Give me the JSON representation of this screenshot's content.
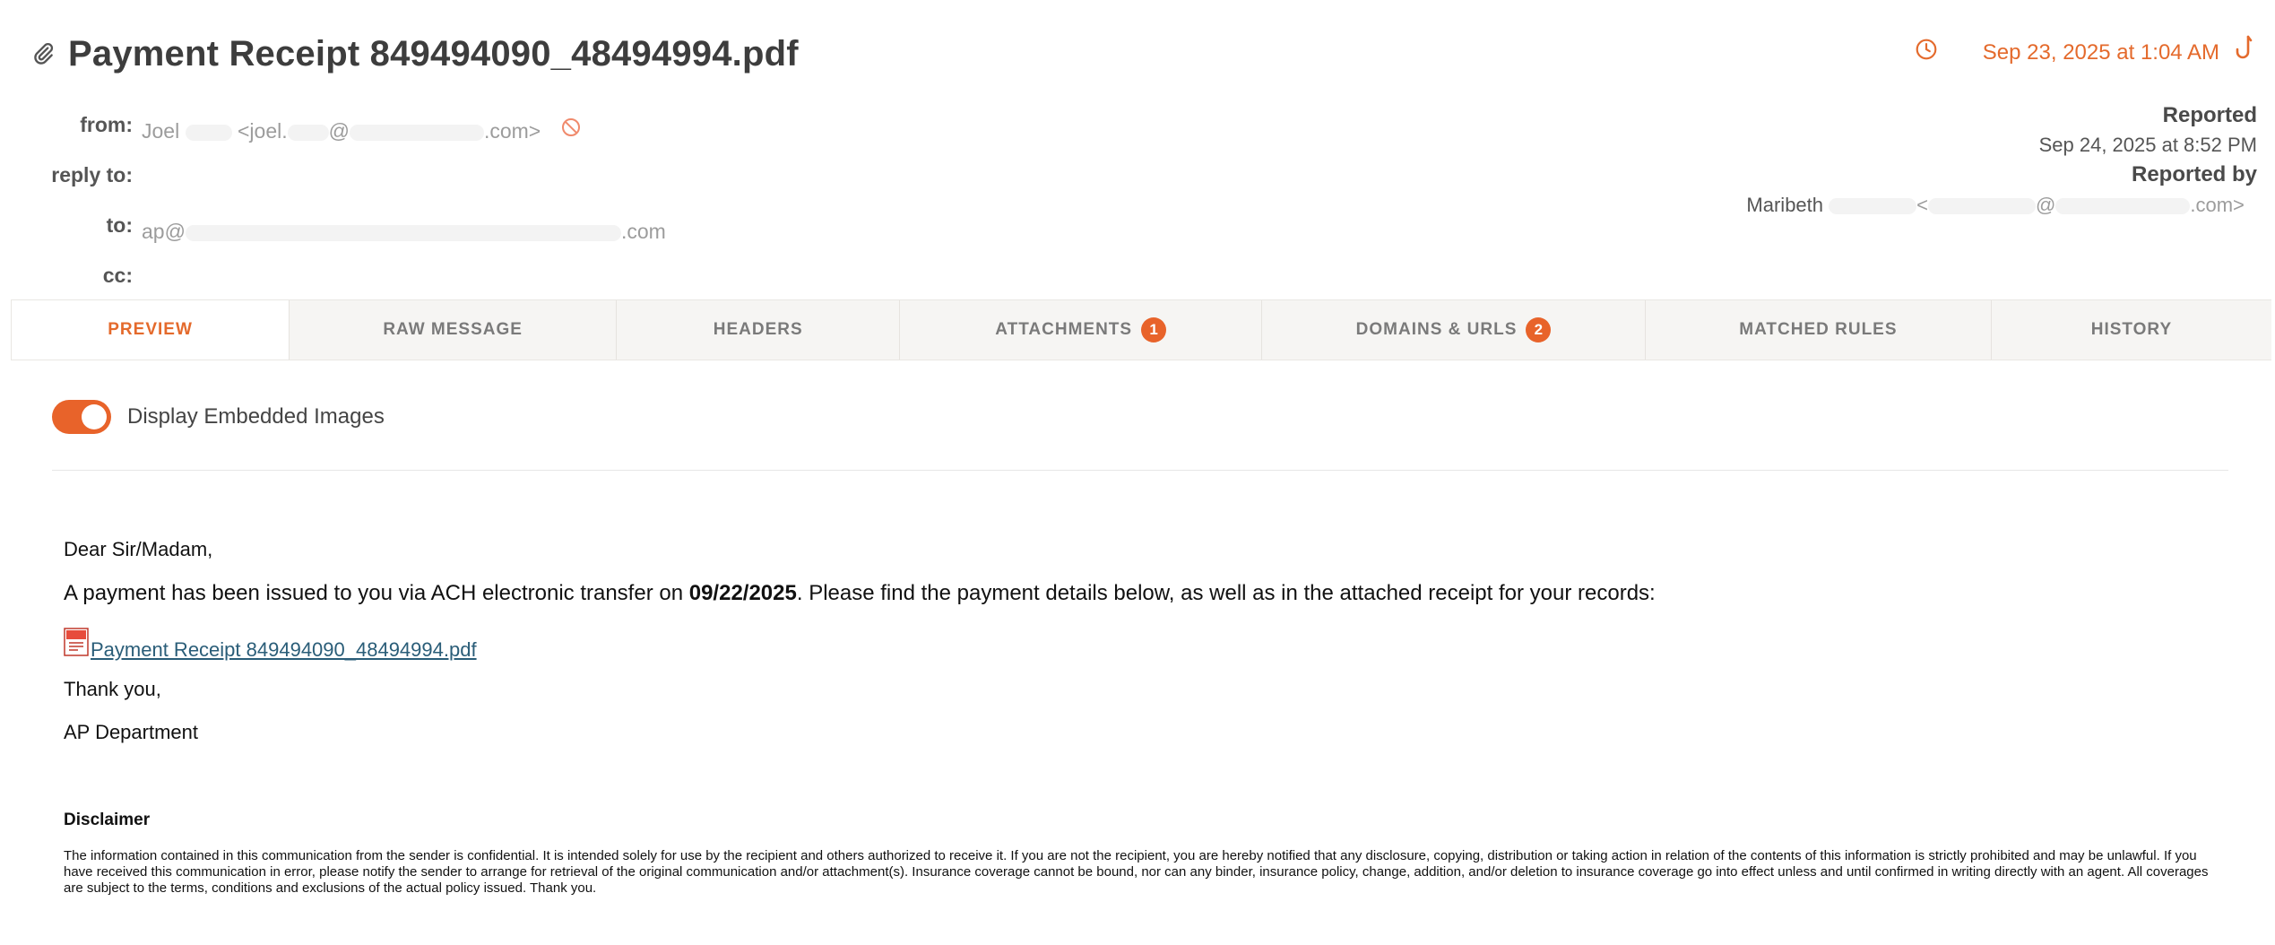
{
  "header": {
    "title": "Payment Receipt 849494090_48494994.pdf",
    "sent_at": "Sep 23, 2025 at 1:04 AM",
    "labels": {
      "from": "from:",
      "reply_to": "reply to:",
      "to": "to:",
      "cc": "cc:"
    },
    "from": {
      "name_prefix": "Joel",
      "email_open": "<joel.",
      "email_at": "@",
      "email_suffix": ".com>"
    },
    "to": {
      "prefix": "ap@",
      "suffix": ".com"
    }
  },
  "report": {
    "reported_label": "Reported",
    "reported_at": "Sep 24, 2025 at 8:52 PM",
    "reported_by_label": "Reported by",
    "reporter_name": "Maribeth",
    "reporter_email_open": "<",
    "reporter_email_at": "@",
    "reporter_email_suffix": ".com>"
  },
  "tabs": [
    {
      "label": "PREVIEW",
      "active": true
    },
    {
      "label": "RAW MESSAGE"
    },
    {
      "label": "HEADERS"
    },
    {
      "label": "ATTACHMENTS",
      "badge": "1"
    },
    {
      "label": "DOMAINS & URLS",
      "badge": "2"
    },
    {
      "label": "MATCHED RULES"
    },
    {
      "label": "HISTORY"
    }
  ],
  "toggle": {
    "label": "Display Embedded Images",
    "on": true
  },
  "message": {
    "greeting": "Dear Sir/Madam,",
    "line_before_date": "A payment has been issued to you via ACH electronic transfer on ",
    "date": "09/22/2025",
    "line_after_date": ". Please find the payment details below, as well as in the attached receipt for your records:",
    "attachment_link": "Payment Receipt 849494090_48494994.pdf",
    "thanks": "Thank you,",
    "signature": "AP Department",
    "disclaimer_title": "Disclaimer",
    "disclaimer_body": "The information contained in this communication from the sender is confidential. It is intended solely for use by the recipient and others authorized to receive it. If you are not the recipient, you are hereby notified that any disclosure, copying, distribution or taking action in relation of the contents of this information is strictly prohibited and may be unlawful. If you have received this communication in error, please notify the sender to arrange for retrieval of the original communication and/or attachment(s). Insurance coverage cannot be bound, nor can any binder, insurance policy, change, addition, and/or deletion to insurance coverage go into effect unless and until confirmed in writing directly with an agent. All coverages are subject to the terms, conditions and exclusions of the actual policy issued. Thank you."
  },
  "colors": {
    "accent": "#e8632a",
    "link": "#2a5d78",
    "muted": "#9c9c9c"
  },
  "icons": [
    "paperclip-icon",
    "clock-icon",
    "hook-icon",
    "block-icon",
    "pdf-file-icon"
  ]
}
